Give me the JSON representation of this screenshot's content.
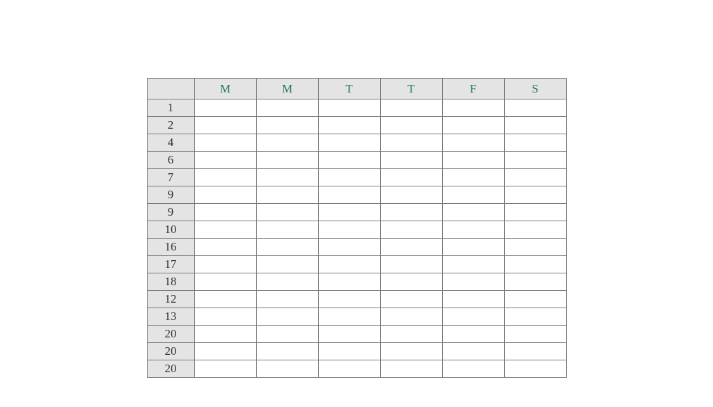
{
  "colors": {
    "header_bg": "#e4e4e4",
    "header_text": "#1b7a4a",
    "row_label_text": "#333333",
    "border": "#7a7a7a",
    "cell_bg": "#ffffff"
  },
  "table": {
    "columns": [
      "M",
      "M",
      "T",
      "T",
      "F",
      "S"
    ],
    "rows": [
      "1",
      "2",
      "4",
      "6",
      "7",
      "9",
      "9",
      "10",
      "16",
      "17",
      "18",
      "12",
      "13",
      "20",
      "20",
      "20"
    ]
  }
}
